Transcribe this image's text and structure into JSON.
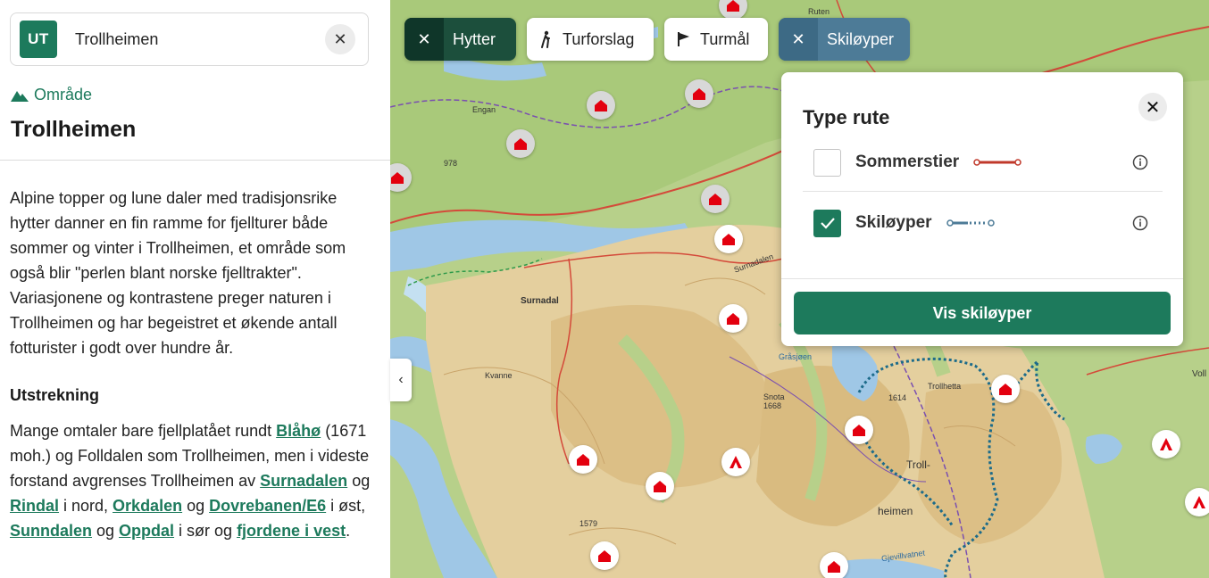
{
  "search": {
    "logo": "UT",
    "value": "Trollheimen",
    "clear_icon": "close-icon"
  },
  "area": {
    "type_label": "Område",
    "icon": "mountain-icon",
    "title": "Trollheimen"
  },
  "intro": "Alpine topper og lune daler med tradisjonsrike hytter danner en fin ramme for fjellturer både sommer og vinter i Trollheimen, et område som også blir \"perlen blant norske fjelltrakter\". Variasjonene og kontrastene preger naturen i Trollheimen og har begeistret et økende antall fotturister i godt over hundre år.",
  "extent": {
    "heading": "Utstrekning",
    "t1": "Mange omtaler bare fjellplatået rundt ",
    "l1": "Blåhø",
    "t2": " (1671 moh.) og Folldalen som Trollheimen, men i videste forstand avgrenses Trollheimen av ",
    "l2": "Surnadalen",
    "t3": " og ",
    "l3": "Rindal",
    "t4": " i nord, ",
    "l4": "Orkdalen",
    "t5": " og ",
    "l5": "Dovrebanen/E6",
    "t6": " i øst, ",
    "l6": "Sunndalen",
    "t7": " og ",
    "l7": "Oppdal",
    "t8": " i sør og ",
    "l8": "fjordene i vest",
    "t9": "."
  },
  "filters": [
    {
      "label": "Hytter",
      "state": "active"
    },
    {
      "label": "Turforslag",
      "state": "inactive",
      "icon": "hiker-icon"
    },
    {
      "label": "Turmål",
      "state": "inactive",
      "icon": "flag-icon"
    },
    {
      "label": "Skiløyper",
      "state": "active"
    }
  ],
  "route_popup": {
    "title": "Type rute",
    "options": [
      {
        "label": "Sommerstier",
        "checked": false,
        "line_color": "#c0392b"
      },
      {
        "label": "Skiløyper",
        "checked": true,
        "line_color": "#4d7b97"
      }
    ],
    "button": "Vis skiløyper"
  },
  "map_labels": {
    "ruten": "Ruten",
    "engan": "Engan",
    "surnadal": "Surnadal",
    "kvanne": "Kvanne",
    "surnadalen": "Surnadalen",
    "grasjoen": "Gråsjøen",
    "snota": "Snota",
    "snota_h": "1668",
    "h1614": "1614",
    "trollhotta": "Trollhetta",
    "troll": "Troll-",
    "heimen": "heimen",
    "gjevillvatnet": "Gjevillvatnet",
    "voll": "Voll",
    "h978": "978",
    "h1579": "1579"
  },
  "colors": {
    "accent": "#1d7a5c",
    "hut_red": "#e3000f",
    "ski_blue": "#4d7b97",
    "summer_red": "#c0392b"
  }
}
